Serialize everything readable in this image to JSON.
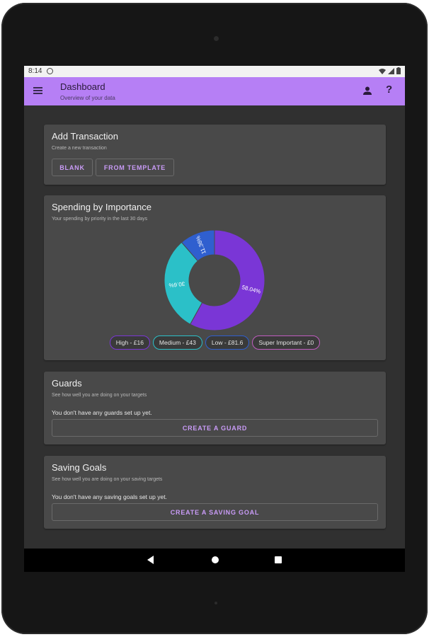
{
  "status_bar": {
    "time": "8:14"
  },
  "app_bar": {
    "title": "Dashboard",
    "subtitle": "Overview of your data"
  },
  "colors": {
    "accent": "#b67ff5",
    "high": "#7a36d6",
    "medium": "#2bc0c8",
    "low": "#2f5fcf",
    "super_important": "#c05cc0"
  },
  "add_transaction": {
    "title": "Add Transaction",
    "subtitle": "Create a new transaction",
    "blank_label": "BLANK",
    "template_label": "FROM TEMPLATE"
  },
  "spending": {
    "title": "Spending by Importance",
    "subtitle": "Your spending by priority in the last 30 days",
    "chart_data": {
      "type": "pie",
      "categories": [
        "High",
        "Medium",
        "Low",
        "Super Important"
      ],
      "values": [
        58.04,
        30.6,
        11.36,
        0
      ],
      "slice_labels": [
        "58.04%",
        "30.6%",
        "11.36%",
        ""
      ],
      "legend_position": "bottom"
    },
    "legend": [
      {
        "label": "High - £16"
      },
      {
        "label": "Medium - £43"
      },
      {
        "label": "Low - £81.6"
      },
      {
        "label": "Super Important - £0"
      }
    ]
  },
  "guards": {
    "title": "Guards",
    "subtitle": "See how well you are doing on your targets",
    "empty": "You don't have any guards set up yet.",
    "button": "CREATE A GUARD"
  },
  "saving_goals": {
    "title": "Saving Goals",
    "subtitle": "See how well you are doing on your saving targets",
    "empty": "You don't have any saving goals set up yet.",
    "button": "CREATE A SAVING GOAL"
  }
}
